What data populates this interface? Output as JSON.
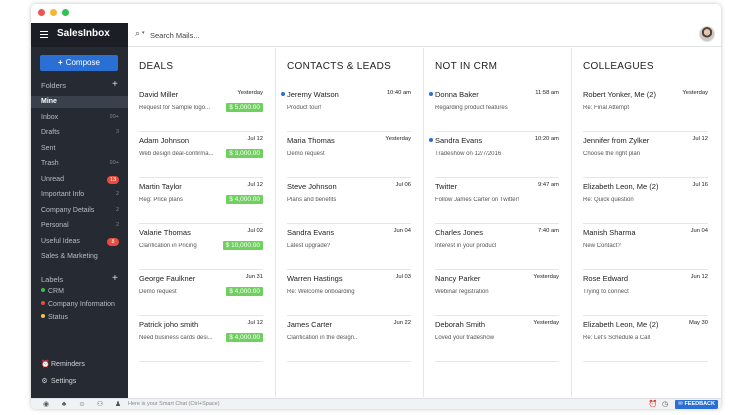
{
  "app": {
    "name": "SalesInbox"
  },
  "sidebar": {
    "compose_label": "Compose",
    "folders_label": "Folders",
    "folders": [
      {
        "label": "Mine",
        "count": ""
      },
      {
        "label": "Inbox",
        "count": "99+"
      },
      {
        "label": "Drafts",
        "count": "3"
      },
      {
        "label": "Sent",
        "count": ""
      },
      {
        "label": "Trash",
        "count": "99+"
      },
      {
        "label": "Unread",
        "badge": "13"
      },
      {
        "label": "Important Info",
        "count": "2"
      },
      {
        "label": "Company Details",
        "count": "2"
      },
      {
        "label": "Personal",
        "count": "2"
      },
      {
        "label": "Useful Ideas",
        "badge": "8"
      },
      {
        "label": "Sales & Marketing",
        "count": ""
      }
    ],
    "labels_label": "Labels",
    "labels": [
      {
        "label": "CRM",
        "color": "#3fb950"
      },
      {
        "label": "Company Information",
        "color": "#e74c3c"
      },
      {
        "label": "Status",
        "color": "#f5c542"
      }
    ],
    "reminders_label": "Reminders",
    "settings_label": "Settings"
  },
  "search": {
    "placeholder": "Search Mails..."
  },
  "columns": [
    {
      "title": "DEALS",
      "cards": [
        {
          "name": "David Miller",
          "time": "Yesterday",
          "subject": "Request for Sample logo...",
          "amount": "$ 5,000.00"
        },
        {
          "name": "Adam Johnson",
          "time": "Jul 12",
          "subject": "Web design deal-confirma...",
          "amount": "$ 3,000.00"
        },
        {
          "name": "Martin Taylor",
          "time": "Jul 12",
          "subject": "Reg: Price plans",
          "amount": "$ 4,000.00"
        },
        {
          "name": "Valarie Thomas",
          "time": "Jul 02",
          "subject": "Clarification in Pricing",
          "amount": "$ 10,000.00"
        },
        {
          "name": "George Faulkner",
          "time": "Jun 31",
          "subject": "Demo request",
          "amount": "$ 4,000.00"
        },
        {
          "name": "Patrick joho smith",
          "time": "Jul 12",
          "subject": "Need business cards desi...",
          "amount": "$ 4,000.00"
        }
      ]
    },
    {
      "title": "CONTACTS & LEADS",
      "cards": [
        {
          "name": "Jeremy Watson",
          "time": "10:40 am",
          "subject": "Product tour!",
          "unread": true
        },
        {
          "name": "Maria Thomas",
          "time": "Yesterday",
          "subject": "Demo request"
        },
        {
          "name": "Steve Johnson",
          "time": "Jul 06",
          "subject": "Plans and benefits"
        },
        {
          "name": "Sandra Evans",
          "time": "Jun 04",
          "subject": "Latest upgrade?"
        },
        {
          "name": "Warren Hastings",
          "time": "Jul 03",
          "subject": "Re: Welcome onboarding"
        },
        {
          "name": "James Carter",
          "time": "Jun 22",
          "subject": "Clarification in the design.."
        }
      ]
    },
    {
      "title": "NOT IN CRM",
      "cards": [
        {
          "name": "Donna Baker",
          "time": "11:58 am",
          "subject": "Regarding product features",
          "unread": true
        },
        {
          "name": "Sandra Evans",
          "time": "10:20 am",
          "subject": "Tradeshow on 12/7/2016",
          "unread": true
        },
        {
          "name": "Twitter",
          "time": "9:47 am",
          "subject": "Follow James Carter on Twitter!"
        },
        {
          "name": "Charles Jones",
          "time": "7:40 am",
          "subject": "Interest in your product"
        },
        {
          "name": "Nancy Parker",
          "time": "Yesterday",
          "subject": "Webinar registration"
        },
        {
          "name": "Deborah Smith",
          "time": "Yesterday",
          "subject": "Loved your tradeshow"
        }
      ]
    },
    {
      "title": "COLLEAGUES",
      "cards": [
        {
          "name": "Robert Yonker, Me (2)",
          "time": "Yesterday",
          "subject": "Re: Final Attempt"
        },
        {
          "name": "Jennifer from Zylker",
          "time": "Jul 12",
          "subject": "Choose the right plan"
        },
        {
          "name": "Elizabeth Leon, Me (2)",
          "time": "Jul 16",
          "subject": "Re: Quick question"
        },
        {
          "name": "Manish Sharma",
          "time": "Jun 04",
          "subject": "New Contact?"
        },
        {
          "name": "Rose Edward",
          "time": "Jun 12",
          "subject": "Trying to connect"
        },
        {
          "name": "Elizabeth Leon, Me (2)",
          "time": "May 30",
          "subject": "Re: Let's Schedule a Call"
        }
      ]
    }
  ],
  "statusbar": {
    "chat_placeholder": "Here is your Smart Chat (Ctrl+Space)",
    "feedback_label": "FEEDBACK"
  },
  "colors": {
    "accent": "#2a6fd3",
    "amount": "#6fcf5f",
    "sidebar": "#262b33",
    "badge": "#e74c3c"
  }
}
